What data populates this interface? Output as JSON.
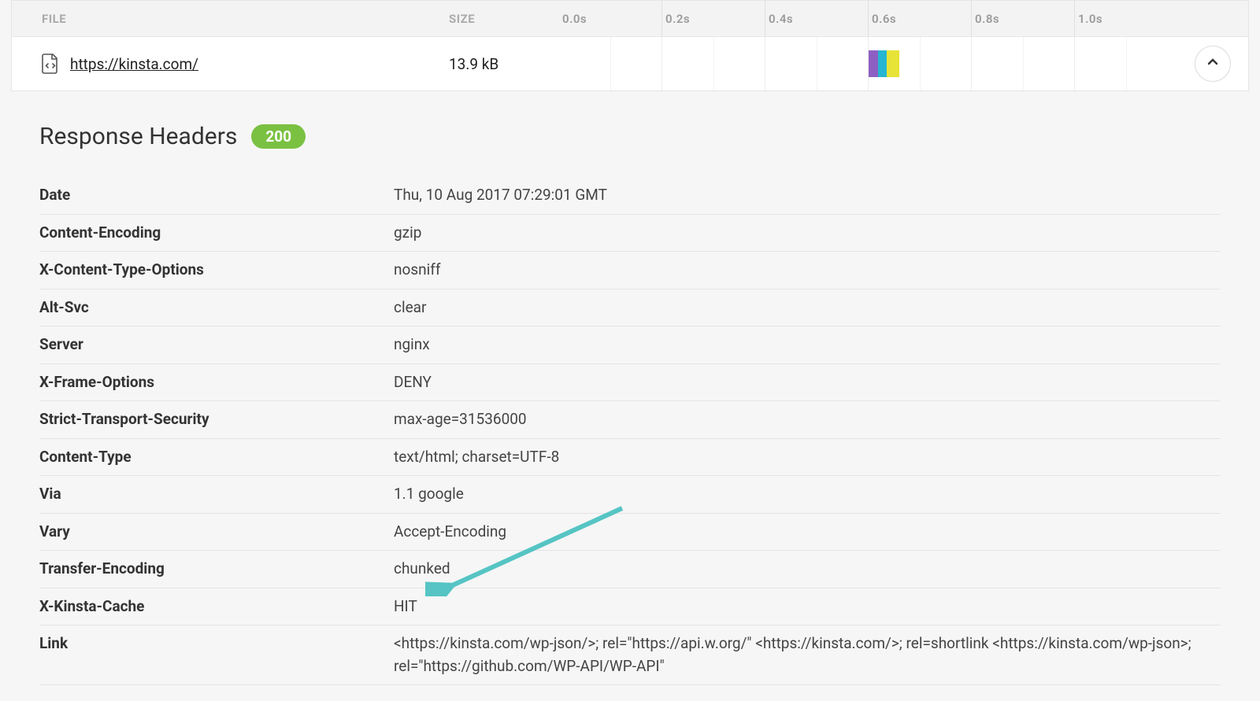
{
  "table_header": {
    "file": "FILE",
    "size": "SIZE"
  },
  "timeline_ticks": [
    "0.0s",
    "0.2s",
    "0.4s",
    "0.6s",
    "0.8s",
    "1.0s"
  ],
  "file_row": {
    "url": "https://kinsta.com/",
    "size": "13.9 kB"
  },
  "waterfall_bars": [
    {
      "color": "#8e5fc2",
      "start_pct": 50.0,
      "width_pct": 1.6
    },
    {
      "color": "#27b6d1",
      "start_pct": 51.6,
      "width_pct": 1.5
    },
    {
      "color": "#e8e337",
      "start_pct": 53.1,
      "width_pct": 2.1
    }
  ],
  "section": {
    "title": "Response Headers",
    "status": "200"
  },
  "annotation_arrow": {
    "target_header": "X-Kinsta-Cache",
    "color": "#56c4c4"
  },
  "headers": [
    {
      "name": "Date",
      "value": "Thu, 10 Aug 2017 07:29:01 GMT"
    },
    {
      "name": "Content-Encoding",
      "value": "gzip"
    },
    {
      "name": "X-Content-Type-Options",
      "value": "nosniff"
    },
    {
      "name": "Alt-Svc",
      "value": "clear"
    },
    {
      "name": "Server",
      "value": "nginx"
    },
    {
      "name": "X-Frame-Options",
      "value": "DENY"
    },
    {
      "name": "Strict-Transport-Security",
      "value": "max-age=31536000"
    },
    {
      "name": "Content-Type",
      "value": "text/html; charset=UTF-8"
    },
    {
      "name": "Via",
      "value": "1.1 google"
    },
    {
      "name": "Vary",
      "value": "Accept-Encoding"
    },
    {
      "name": "Transfer-Encoding",
      "value": "chunked"
    },
    {
      "name": "X-Kinsta-Cache",
      "value": "HIT"
    },
    {
      "name": "Link",
      "value": "<https://kinsta.com/wp-json/>; rel=\"https://api.w.org/\" <https://kinsta.com/>; rel=shortlink <https://kinsta.com/wp-json>; rel=\"https://github.com/WP-API/WP-API\""
    }
  ]
}
